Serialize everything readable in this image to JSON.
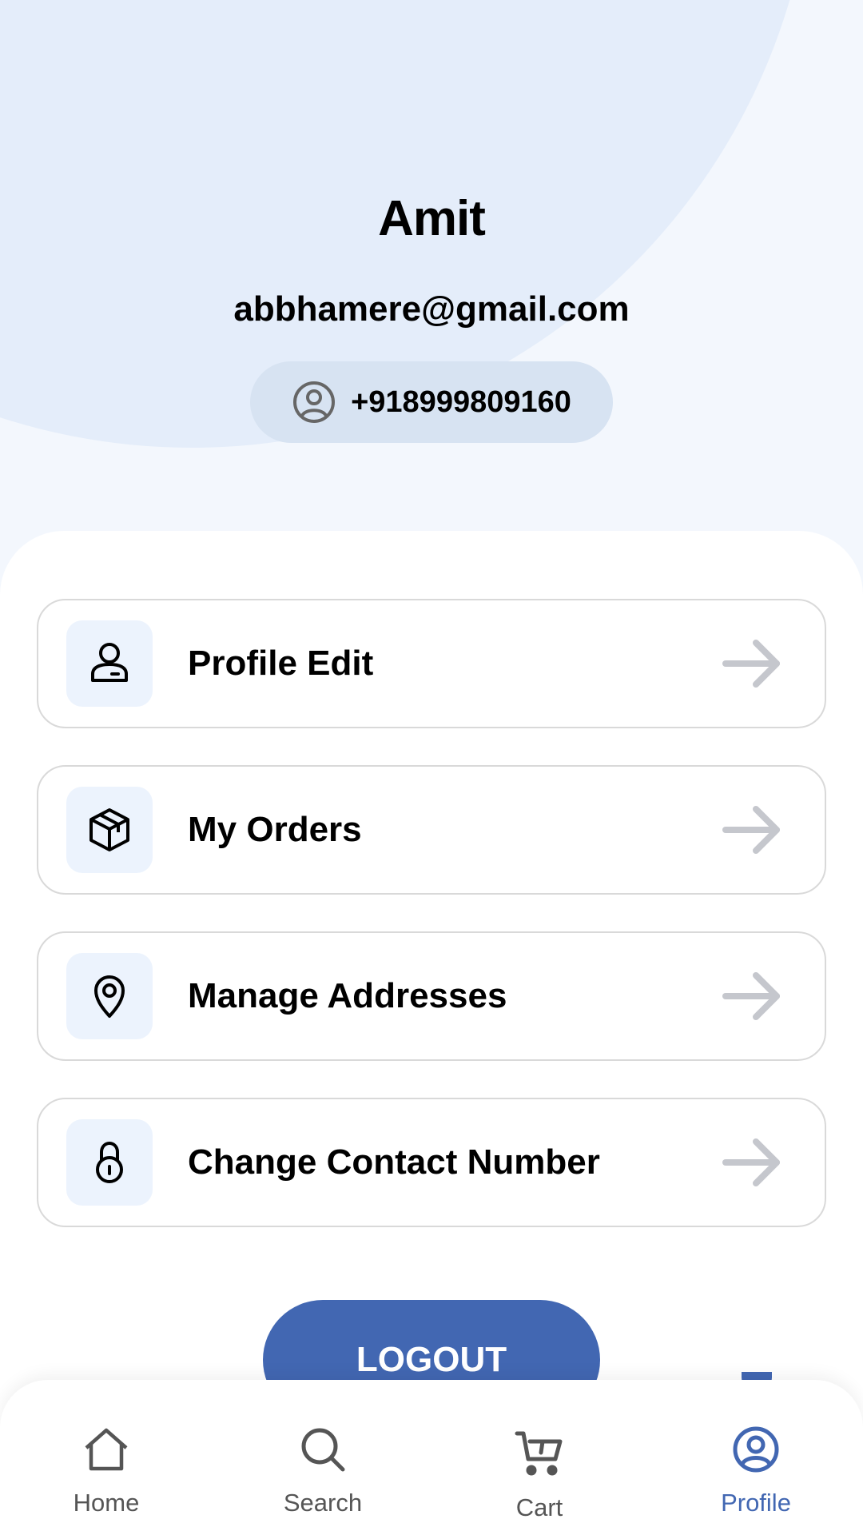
{
  "profile": {
    "name": "Amit",
    "email": "abbhamere@gmail.com",
    "phone": "+918999809160"
  },
  "menu": [
    {
      "label": "Profile Edit",
      "icon": "user-icon"
    },
    {
      "label": "My Orders",
      "icon": "box-icon"
    },
    {
      "label": "Manage Addresses",
      "icon": "location-pin-icon"
    },
    {
      "label": "Change Contact Number",
      "icon": "lock-icon"
    }
  ],
  "logout_label": "LOGOUT",
  "nav": [
    {
      "label": "Home",
      "icon": "home-icon"
    },
    {
      "label": "Search",
      "icon": "search-icon"
    },
    {
      "label": "Cart",
      "icon": "cart-icon"
    },
    {
      "label": "Profile",
      "icon": "profile-icon",
      "active": true
    }
  ],
  "colors": {
    "accent": "#4267b2",
    "background": "#f3f7fd",
    "pill": "#d7e3f2",
    "icon_box": "#ecf3fd",
    "arrow": "#c5c7cd"
  }
}
